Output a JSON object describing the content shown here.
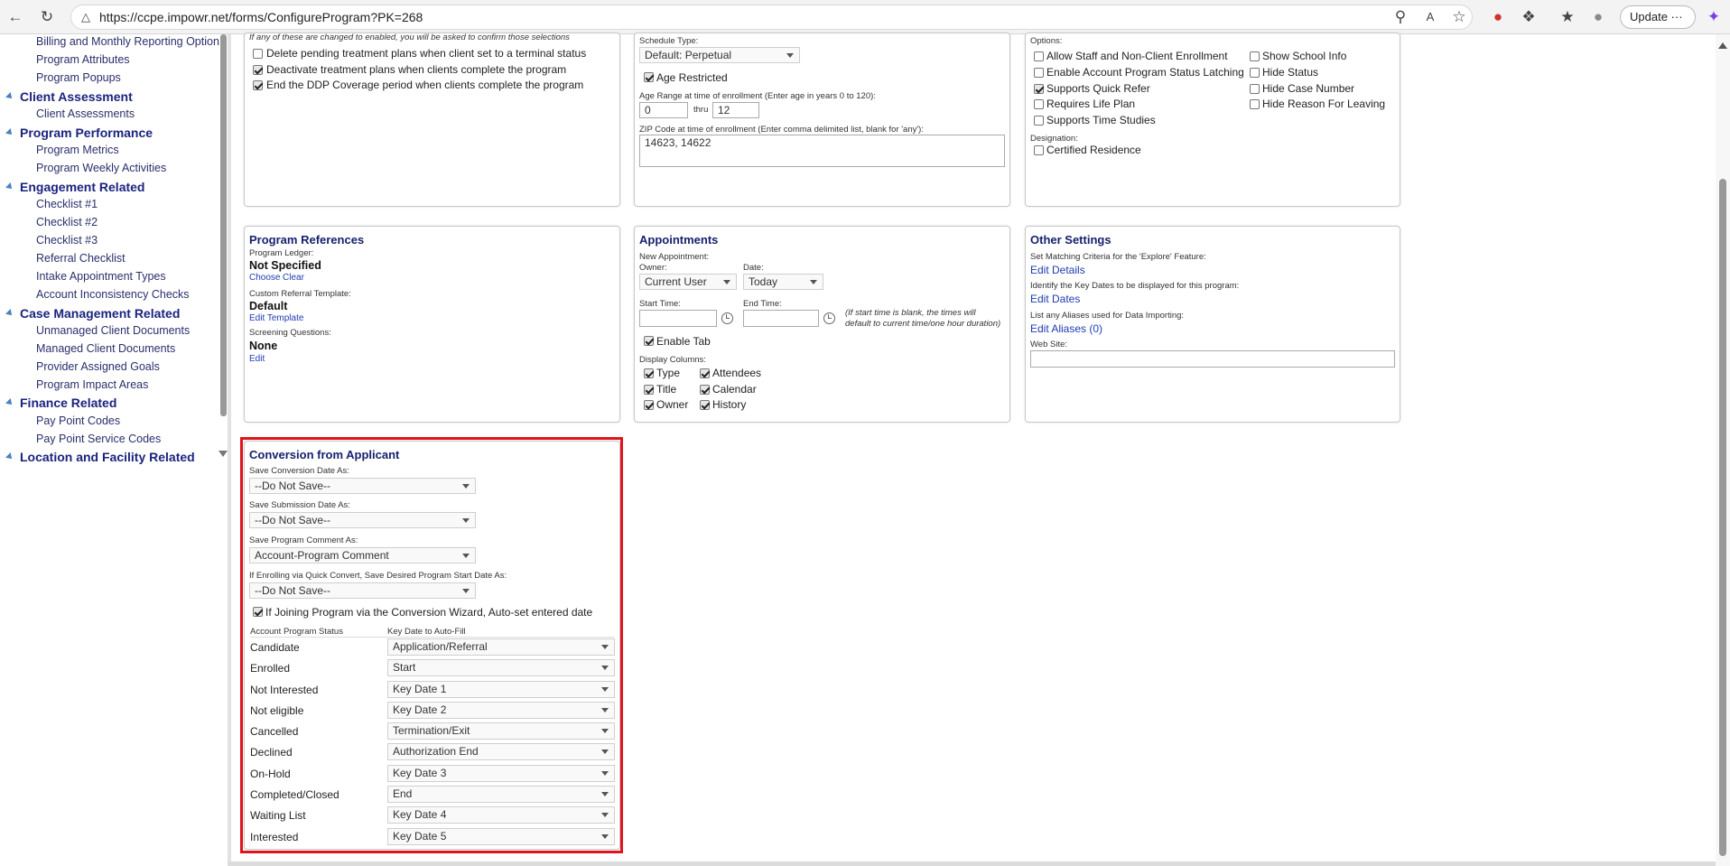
{
  "browser": {
    "url": "https://ccpe.impowr.net/forms/ConfigureProgram?PK=268",
    "update_label": "Update",
    "more_label": "···"
  },
  "sidebar": {
    "items": [
      {
        "kind": "sub",
        "label": "Billing and Monthly Reporting Option"
      },
      {
        "kind": "sub",
        "label": "Program Attributes"
      },
      {
        "kind": "sub",
        "label": "Program Popups"
      },
      {
        "kind": "section",
        "label": "Client Assessment"
      },
      {
        "kind": "sub",
        "label": "Client Assessments"
      },
      {
        "kind": "section",
        "label": "Program Performance"
      },
      {
        "kind": "sub",
        "label": "Program Metrics"
      },
      {
        "kind": "sub",
        "label": "Program Weekly Activities"
      },
      {
        "kind": "section",
        "label": "Engagement Related"
      },
      {
        "kind": "sub",
        "label": "Checklist #1"
      },
      {
        "kind": "sub",
        "label": "Checklist #2"
      },
      {
        "kind": "sub",
        "label": "Checklist #3"
      },
      {
        "kind": "sub",
        "label": "Referral Checklist"
      },
      {
        "kind": "sub",
        "label": "Intake Appointment Types"
      },
      {
        "kind": "sub",
        "label": "Account Inconsistency Checks"
      },
      {
        "kind": "section",
        "label": "Case Management Related"
      },
      {
        "kind": "sub",
        "label": "Unmanaged Client Documents"
      },
      {
        "kind": "sub",
        "label": "Managed Client Documents"
      },
      {
        "kind": "sub",
        "label": "Provider Assigned Goals"
      },
      {
        "kind": "sub",
        "label": "Program Impact Areas"
      },
      {
        "kind": "section",
        "label": "Finance Related"
      },
      {
        "kind": "sub",
        "label": "Pay Point Codes"
      },
      {
        "kind": "sub",
        "label": "Pay Point Service Codes"
      },
      {
        "kind": "section",
        "label": "Location and Facility Related"
      }
    ]
  },
  "treatment": {
    "note": "If any of these are changed to enabled, you will be asked to confirm those selections",
    "opt1": "Delete pending treatment plans when client set to a terminal status",
    "opt2": "Deactivate treatment plans when clients complete the program",
    "opt3": "End the DDP Coverage period when clients complete the program"
  },
  "schedule": {
    "type_label": "Schedule Type:",
    "type_value": "Default: Perpetual",
    "age_restricted": "Age Restricted",
    "age_range_label": "Age Range at time of enrollment (Enter age in years 0 to 120):",
    "age_from": "0",
    "thru": "thru",
    "age_to": "12",
    "zip_label": "ZIP Code at time of enrollment (Enter comma delimited list, blank for 'any'):",
    "zip_value": "14623, 14622"
  },
  "options": {
    "label": "Options:",
    "left": [
      "Allow Staff and Non-Client Enrollment",
      "Enable Account Program Status Latching",
      "Supports Quick Refer",
      "Requires Life Plan",
      "Supports Time Studies"
    ],
    "right": [
      "Show School Info",
      "Hide Status",
      "Hide Case Number",
      "Hide Reason For Leaving"
    ],
    "designation_label": "Designation:",
    "certified": "Certified Residence"
  },
  "references": {
    "title": "Program References",
    "ledger_label": "Program Ledger:",
    "ledger_value": "Not Specified",
    "choose": "Choose",
    "clear": "Clear",
    "template_label": "Custom Referral Template:",
    "template_value": "Default",
    "edit_template": "Edit Template",
    "screening_label": "Screening Questions:",
    "screening_value": "None",
    "edit": "Edit"
  },
  "appointments": {
    "title": "Appointments",
    "new_label": "New Appointment:",
    "owner_label": "Owner:",
    "owner_value": "Current User",
    "date_label": "Date:",
    "date_value": "Today",
    "start_label": "Start Time:",
    "end_label": "End Time:",
    "note1": "(If start time is blank, the times will",
    "note2": "default to current time/one hour duration)",
    "enable_tab": "Enable Tab",
    "columns_label": "Display Columns:",
    "col_left": [
      "Type",
      "Title",
      "Owner"
    ],
    "col_right": [
      "Attendees",
      "Calendar",
      "History"
    ]
  },
  "other": {
    "title": "Other Settings",
    "match_label": "Set Matching Criteria for the 'Explore' Feature:",
    "edit_details": "Edit Details",
    "keydates_label": "Identify the Key Dates to be displayed for this program:",
    "edit_dates": "Edit Dates",
    "aliases_label": "List any Aliases used for Data Importing:",
    "edit_aliases": "Edit Aliases (0)",
    "website_label": "Web Site:"
  },
  "conversion": {
    "title": "Conversion from Applicant",
    "conv_date_label": "Save Conversion Date As:",
    "conv_date_value": "--Do Not Save--",
    "sub_date_label": "Save Submission Date As:",
    "sub_date_value": "--Do Not Save--",
    "comment_label": "Save Program Comment As:",
    "comment_value": "Account-Program Comment",
    "quick_label": "If Enrolling via Quick Convert, Save Desired Program Start Date As:",
    "quick_value": "--Do Not Save--",
    "wizard_label": "If Joining Program via the Conversion Wizard, Auto-set entered date",
    "col_status": "Account Program Status",
    "col_keydate": "Key Date to Auto-Fill",
    "rows": [
      {
        "status": "Candidate",
        "keydate": "Application/Referral"
      },
      {
        "status": "Enrolled",
        "keydate": "Start"
      },
      {
        "status": "Not Interested",
        "keydate": "Key Date 1"
      },
      {
        "status": "Not eligible",
        "keydate": "Key Date 2"
      },
      {
        "status": "Cancelled",
        "keydate": "Termination/Exit"
      },
      {
        "status": "Declined",
        "keydate": "Authorization End"
      },
      {
        "status": "On-Hold",
        "keydate": "Key Date 3"
      },
      {
        "status": "Completed/Closed",
        "keydate": "End"
      },
      {
        "status": "Waiting List",
        "keydate": "Key Date 4"
      },
      {
        "status": "Interested",
        "keydate": "Key Date 5"
      }
    ]
  }
}
